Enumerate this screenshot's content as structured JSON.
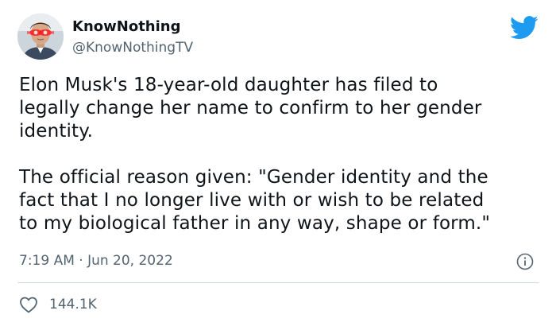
{
  "author": {
    "display_name": "KnowNothing",
    "handle": "@KnowNothingTV",
    "avatar_icon": "avatar-glowing-eyes"
  },
  "tweet": {
    "paragraphs": [
      "Elon Musk's 18-year-old daughter has filed to\nlegally change her name to confirm to her gender\nidentity.",
      "The official reason given: \"Gender identity and the\nfact that I no longer live with or wish to be related\nto my biological father in any way, shape or form.\""
    ],
    "timestamp": "7:19 AM · Jun 20, 2022",
    "likes": "144.1K"
  },
  "icons": {
    "logo": "twitter-bird-icon",
    "info": "info-icon",
    "like": "heart-icon"
  },
  "colors": {
    "twitter_blue": "#1d9bf0",
    "secondary_text": "#536471",
    "primary_text": "#0f1419",
    "divider": "#cfd9de"
  }
}
